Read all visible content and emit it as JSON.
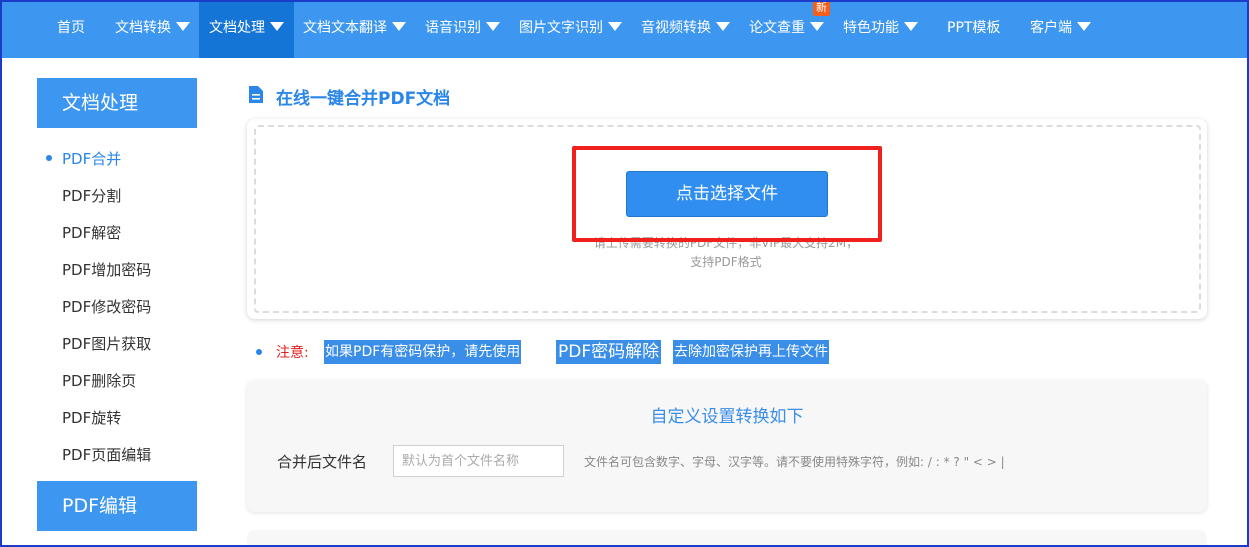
{
  "nav": {
    "items": [
      {
        "label": "首页",
        "caret": false
      },
      {
        "label": "文档转换",
        "caret": true
      },
      {
        "label": "文档处理",
        "caret": true,
        "active": true
      },
      {
        "label": "文档文本翻译",
        "caret": true
      },
      {
        "label": "语音识别",
        "caret": true
      },
      {
        "label": "图片文字识别",
        "caret": true
      },
      {
        "label": "音视频转换",
        "caret": true
      },
      {
        "label": "论文查重",
        "caret": true,
        "badge": "新"
      },
      {
        "label": "特色功能",
        "caret": true
      },
      {
        "label": "PPT模板",
        "caret": false
      },
      {
        "label": "客户端",
        "caret": true
      }
    ]
  },
  "sidebar": {
    "section1_title": "文档处理",
    "items": [
      {
        "label": "PDF合并",
        "active": true
      },
      {
        "label": "PDF分割"
      },
      {
        "label": "PDF解密"
      },
      {
        "label": "PDF增加密码"
      },
      {
        "label": "PDF修改密码"
      },
      {
        "label": "PDF图片获取"
      },
      {
        "label": "PDF删除页"
      },
      {
        "label": "PDF旋转"
      },
      {
        "label": "PDF页面编辑"
      }
    ],
    "section2_title": "PDF编辑"
  },
  "main": {
    "title": "在线一键合并PDF文档",
    "upload_button": "点击选择文件",
    "upload_hint": "请上传需要转换的PDF文件，非VIP最大支持2M，",
    "upload_hint2": "支持PDF格式",
    "notice_label": "注意:",
    "notice_part1": "如果PDF有密码保护，请先使用",
    "notice_link": "PDF密码解除",
    "notice_part2": "去除加密保护再上传文件"
  },
  "settings": {
    "title": "自定义设置转换如下",
    "filename_label": "合并后文件名",
    "filename_placeholder": "默认为首个文件名称",
    "filename_hint": "文件名可包含数字、字母、汉字等。请不要使用特殊字符，例如:  / : * ? \" < > |"
  },
  "colors": {
    "nav_bg": "#3d97f0",
    "nav_active": "#1475d6",
    "accent": "#2a86e8",
    "highlight_box": "#f0201c",
    "notice_red": "#e02020"
  }
}
